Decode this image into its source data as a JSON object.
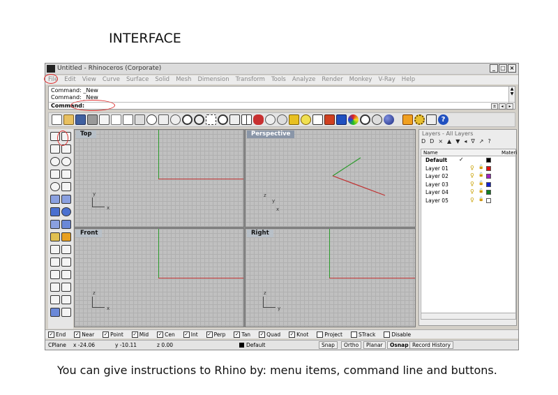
{
  "slide": {
    "title": "INTERFACE",
    "caption": "You can give instructions to Rhino by: menu items, command line and buttons."
  },
  "window": {
    "title": "Untitled - Rhinoceros (Corporate)",
    "controls": [
      "_",
      "□",
      "×"
    ]
  },
  "menu": [
    "File",
    "Edit",
    "View",
    "Curve",
    "Surface",
    "Solid",
    "Mesh",
    "Dimension",
    "Transform",
    "Tools",
    "Analyze",
    "Render",
    "Monkey",
    "V-Ray",
    "Help"
  ],
  "command": {
    "history": [
      "Command: _New",
      "Command: _New"
    ],
    "prompt": "Command:"
  },
  "viewports": {
    "top": "Top",
    "perspective": "Perspective",
    "front": "Front",
    "right": "Right",
    "axes": {
      "top": [
        "y",
        "x"
      ],
      "perspective": [
        "z",
        "y",
        "x"
      ],
      "front": [
        "z",
        "x"
      ],
      "right": [
        "z",
        "y"
      ]
    }
  },
  "layers": {
    "title": "Layers - All Layers",
    "tools": [
      "D",
      "D",
      "×",
      "▲",
      "▼",
      "◂",
      "∇",
      "↗",
      "?"
    ],
    "columns": [
      "Name",
      "Materi"
    ],
    "rows": [
      {
        "name": "Default",
        "current": true,
        "color": "#000000"
      },
      {
        "name": "Layer 01",
        "color": "#e01010"
      },
      {
        "name": "Layer 02",
        "color": "#a020c0"
      },
      {
        "name": "Layer 03",
        "color": "#1020d0"
      },
      {
        "name": "Layer 04",
        "color": "#108020"
      },
      {
        "name": "Layer 05",
        "color": "#ffffff"
      }
    ],
    "check": "✓"
  },
  "osnap": [
    {
      "label": "End",
      "on": true
    },
    {
      "label": "Near",
      "on": true
    },
    {
      "label": "Point",
      "on": true
    },
    {
      "label": "Mid",
      "on": true
    },
    {
      "label": "Cen",
      "on": true
    },
    {
      "label": "Int",
      "on": true
    },
    {
      "label": "Perp",
      "on": true
    },
    {
      "label": "Tan",
      "on": true
    },
    {
      "label": "Quad",
      "on": true
    },
    {
      "label": "Knot",
      "on": true
    },
    {
      "label": "Project",
      "on": false
    },
    {
      "label": "STrack",
      "on": false
    },
    {
      "label": "Disable",
      "on": false
    }
  ],
  "status": {
    "cplane": "CPlane",
    "x": "x -24.06",
    "y": "y -10.11",
    "z": "z 0.00",
    "layer": "Default",
    "buttons": [
      "Snap",
      "Ortho",
      "Planar",
      "Osnap",
      "Record History"
    ]
  },
  "colors": {
    "red_annotation": "#e03030",
    "axis_x": "#c03030",
    "axis_y": "#2a9a2a"
  }
}
